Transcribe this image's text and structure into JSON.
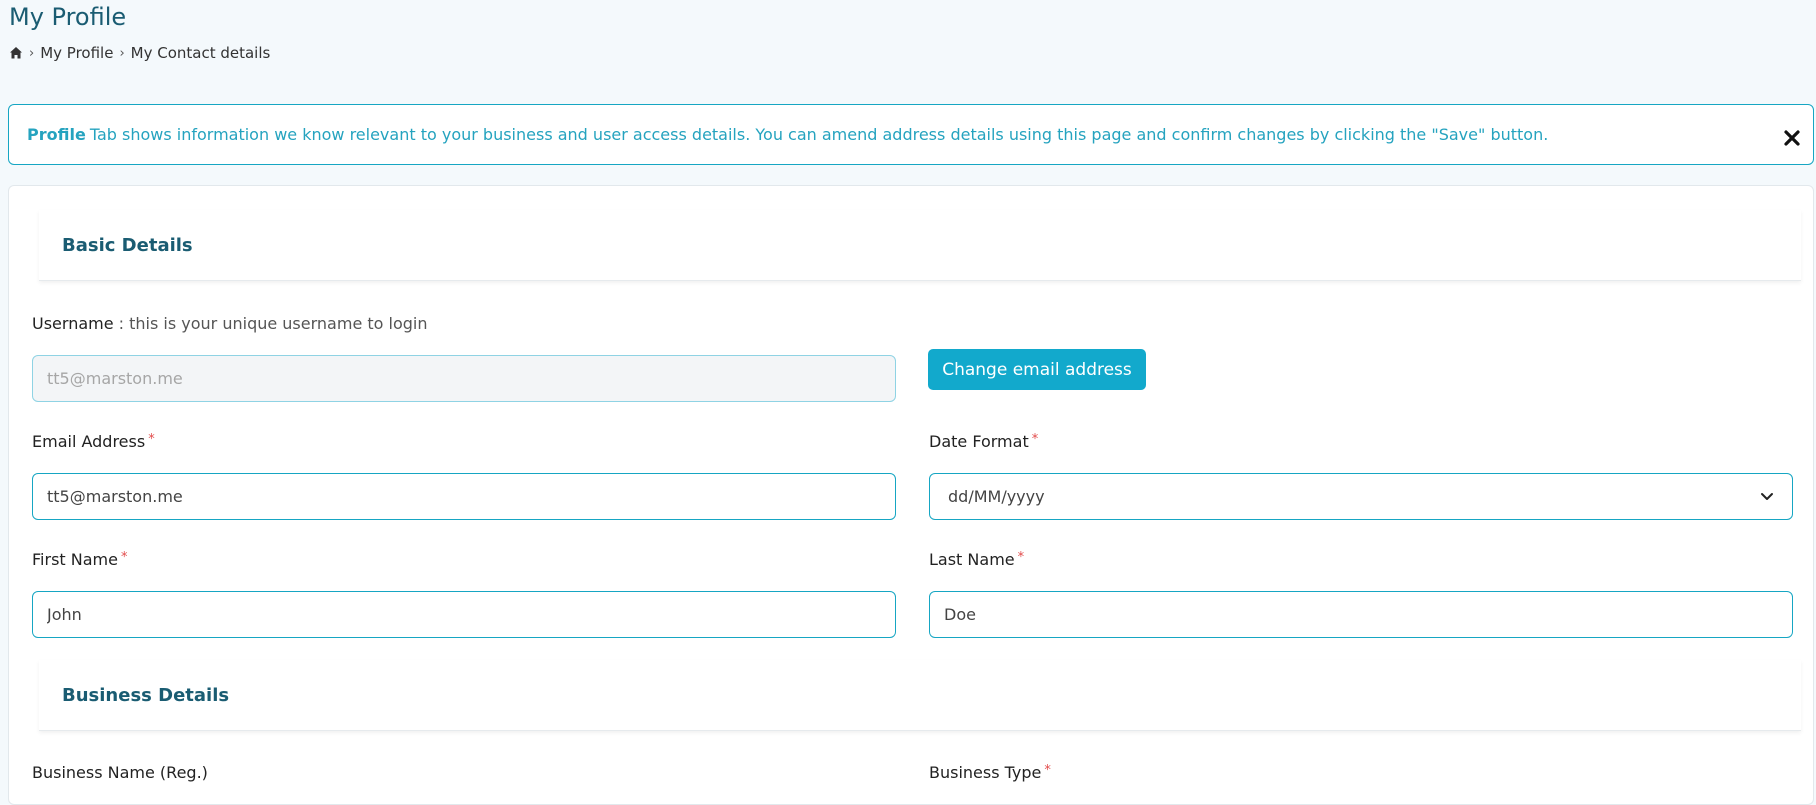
{
  "page": {
    "title": "My Profile"
  },
  "breadcrumb": {
    "items": [
      "My Profile",
      "My Contact details"
    ]
  },
  "info_banner": {
    "strong": "Profile",
    "text": "Tab shows information we know relevant to your business and user access details. You can amend address details using this page and confirm changes by clicking the \"Save\" button."
  },
  "basic_details": {
    "title": "Basic Details",
    "username": {
      "label": "Username",
      "hint": " : this is your unique username to login",
      "value": "tt5@marston.me"
    },
    "change_email_label": "Change email address",
    "email": {
      "label": "Email Address",
      "value": "tt5@marston.me"
    },
    "date_format": {
      "label": "Date Format",
      "value": "dd/MM/yyyy"
    },
    "first_name": {
      "label": "First Name",
      "value": "John"
    },
    "last_name": {
      "label": "Last Name",
      "value": "Doe"
    }
  },
  "business_details": {
    "title": "Business Details",
    "business_name_label": "Business Name (Reg.)",
    "business_type_label": "Business Type"
  },
  "required_marker": "*",
  "colors": {
    "accent": "#12a9cc",
    "title": "#1a5c72",
    "required": "#e24b4b"
  },
  "icons": {
    "home": "home-icon",
    "close": "close-icon",
    "chevron": "chevron-down-icon"
  }
}
